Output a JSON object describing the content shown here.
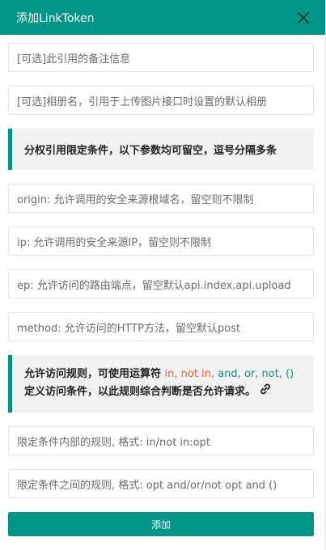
{
  "dialog": {
    "title": "添加LinkToken",
    "close_icon": "close-icon"
  },
  "fields": {
    "remark": "[可选]此引用的备注信息",
    "album": "[可选]相册名，引用于上传图片接口时设置的默认相册",
    "origin": "origin: 允许调用的安全来源根域名，留空则不限制",
    "ip": "ip: 允许调用的安全来源IP，留空则不限制",
    "ep": "ep: 允许访问的路由端点，留空默认api.index,api.upload",
    "method": "method: 允许访问的HTTP方法，留空默认post",
    "inner_rule": "限定条件内部的规则, 格式: in/not in:opt",
    "outer_rule": "限定条件之间的规则, 格式: opt and/or/not opt and ()"
  },
  "notes": {
    "restrict": "分权引用限定条件，以下参数均可留空，逗号分隔多条",
    "rules_prefix": "允许访问规则，可使用运算符 ",
    "op_in": "in",
    "sep1": ", ",
    "op_not_in": "not in",
    "sep2": ", ",
    "op_and": "and",
    "sep3": ", ",
    "op_or": "or",
    "sep4": ", ",
    "op_not": "not",
    "sep5": ", ",
    "op_paren": "()",
    "rules_line2": "定义访问条件，以此规则综合判断是否允许请求。"
  },
  "submit_label": "添加",
  "colors": {
    "accent": "#009587",
    "operator_red": "#ff5722"
  }
}
